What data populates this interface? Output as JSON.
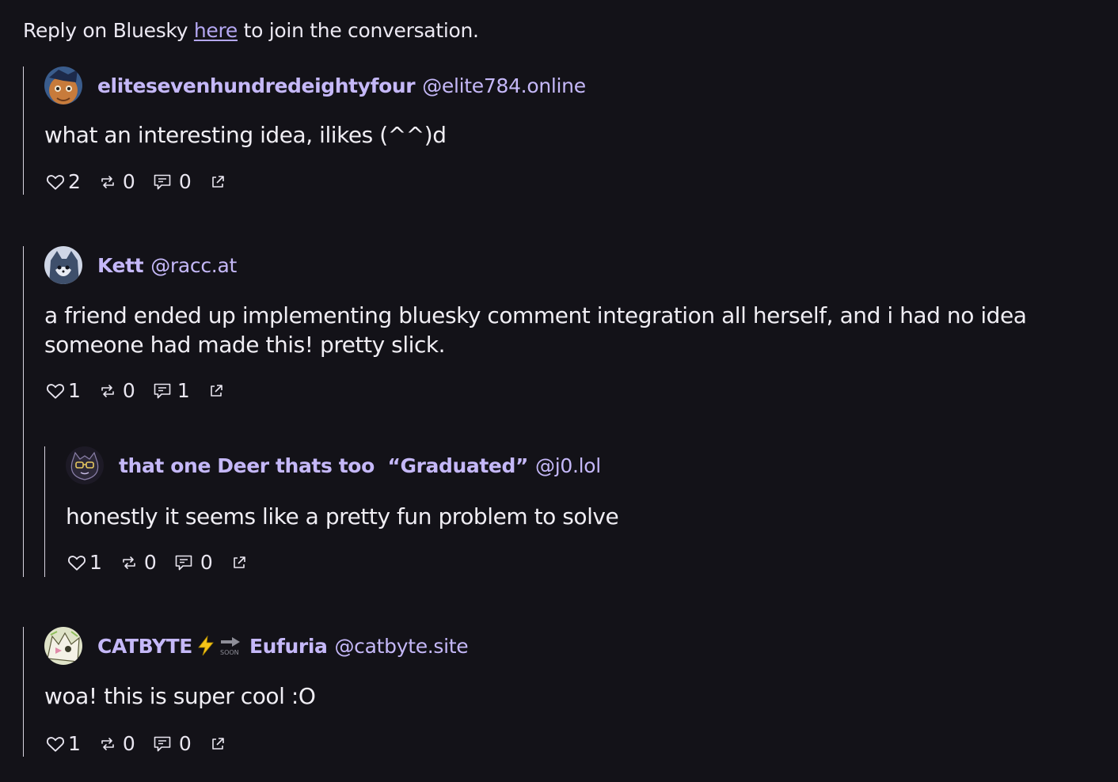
{
  "reply_prompt": {
    "before": "Reply on Bluesky ",
    "link": "here",
    "after": " to join the conversation."
  },
  "comments": [
    {
      "name": "elitesevenhundredeightyfour",
      "handle": "@elite784.online",
      "text": "what an interesting idea, ilikes (^^)d",
      "likes": "2",
      "reposts": "0",
      "replies": "0"
    },
    {
      "name": "Kett",
      "handle": "@racc.at",
      "text_lines": [
        "a friend ended up implementing bluesky comment integration all herself, and i had no idea",
        "someone had made this! pretty slick."
      ],
      "likes": "1",
      "reposts": "0",
      "replies": "1",
      "children": [
        {
          "name": "that one Deer thats too  “Graduated”",
          "handle": "@j0.lol",
          "text": "honestly it seems like a pretty fun problem to solve",
          "likes": "1",
          "reposts": "0",
          "replies": "0"
        }
      ]
    },
    {
      "name_parts": [
        "CATBYTE",
        "Eufuria"
      ],
      "name_emoji": [
        "lightning-icon",
        "soon-arrow-icon"
      ],
      "handle": "@catbyte.site",
      "text": "woa! this is super cool :O",
      "likes": "1",
      "reposts": "0",
      "replies": "0"
    }
  ],
  "colors": {
    "background": "#131218",
    "accent": "#c5b8f8",
    "link": "#b4a7f2",
    "text": "#f0eef4",
    "thread_line": "#d7d3df"
  },
  "icons": [
    "heart-icon",
    "repost-icon",
    "reply-icon",
    "external-link-icon"
  ]
}
